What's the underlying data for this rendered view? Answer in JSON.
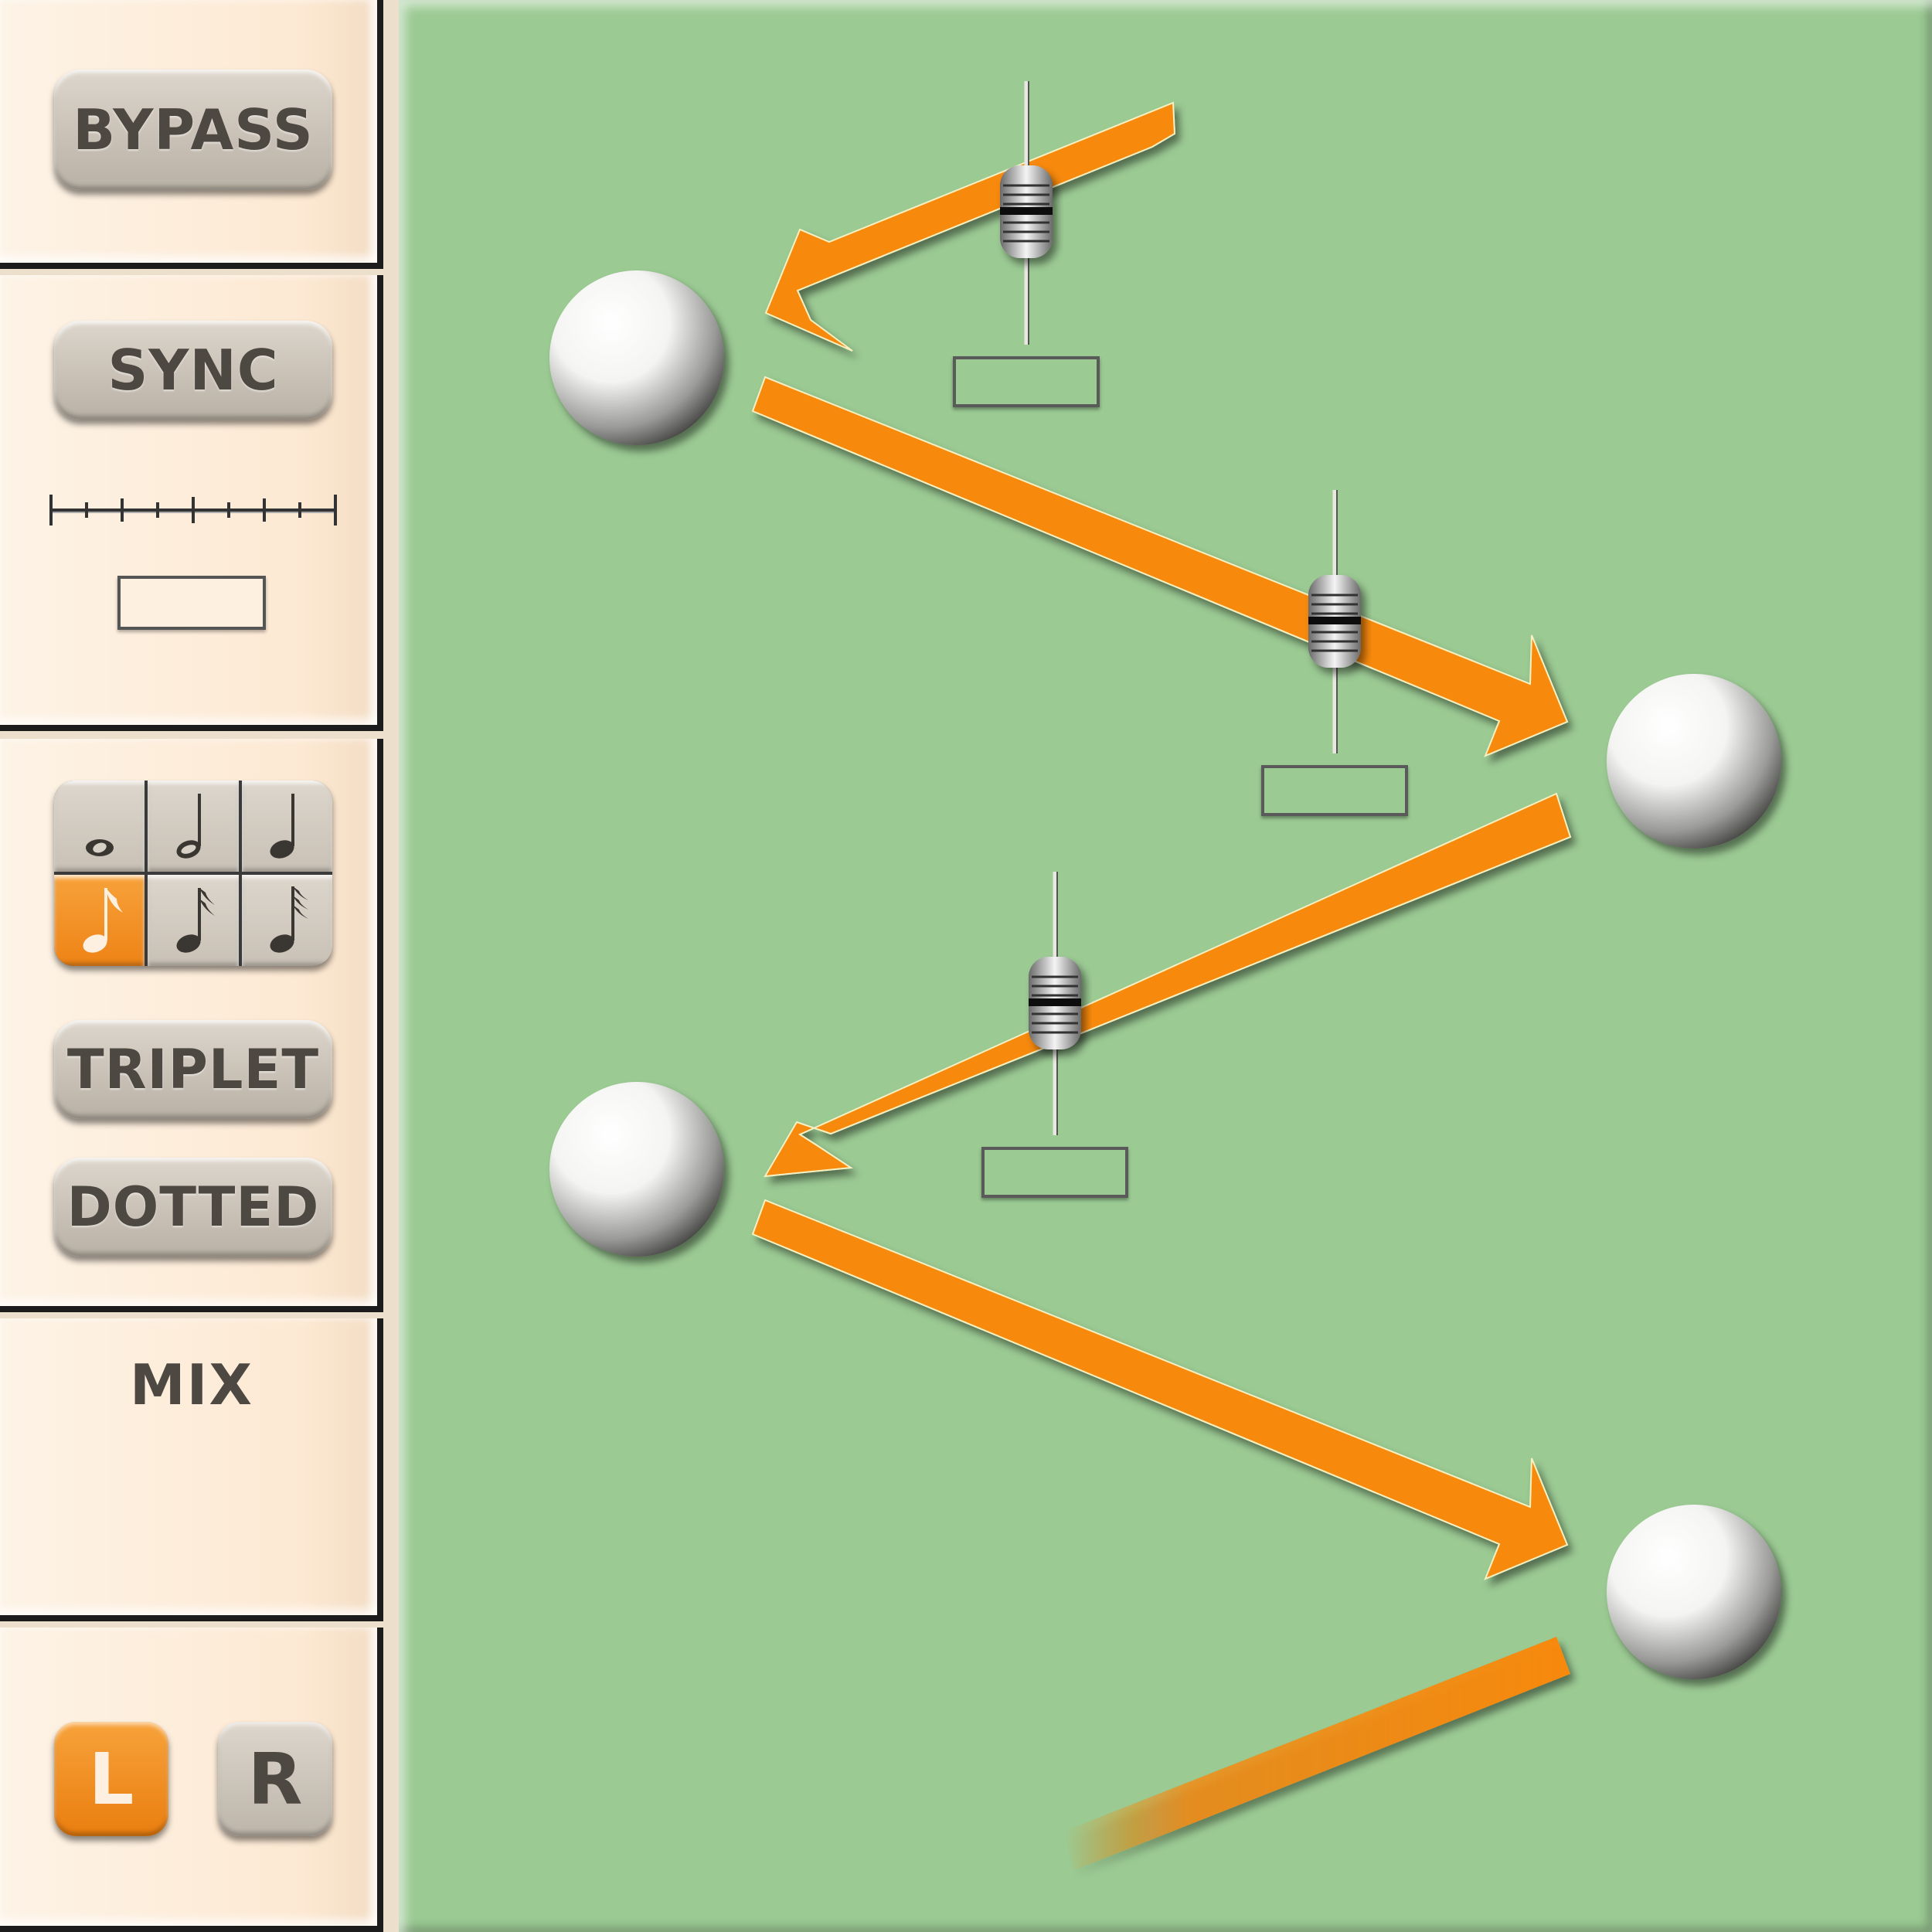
{
  "sidebar": {
    "bypass_label": "BYPASS",
    "sync_label": "SYNC",
    "note_values": [
      {
        "icon": "whole-note-icon",
        "active": false
      },
      {
        "icon": "half-note-icon",
        "active": false
      },
      {
        "icon": "quarter-note-icon",
        "active": false
      },
      {
        "icon": "eighth-note-icon",
        "active": true
      },
      {
        "icon": "sixteenth-note-icon",
        "active": false
      },
      {
        "icon": "thirty-second-note-icon",
        "active": false
      }
    ],
    "triplet_label": "TRIPLET",
    "dotted_label": "DOTTED",
    "mix_label": "MIX",
    "left_label": "L",
    "right_label": "R",
    "left_active": true,
    "right_active": false
  },
  "colors": {
    "panel_bg": "#fde9d3",
    "main_bg": "#9bca93",
    "accent_orange": "#f7890d",
    "button_grey": "#cbc3b8",
    "text_dark": "#4d4942"
  },
  "main": {
    "nodes": 4,
    "sliders": 3
  }
}
